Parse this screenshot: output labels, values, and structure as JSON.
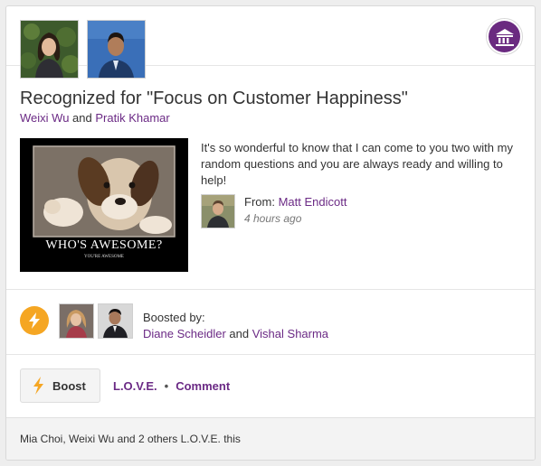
{
  "recognition": {
    "title": "Recognized for \"Focus on Customer Happiness\"",
    "recipients": [
      {
        "name": "Weixi Wu"
      },
      {
        "name": "Pratik Khamar"
      }
    ],
    "connector": "and",
    "badge_icon": "building-icon",
    "badge_color": "#6a2a80",
    "link_color": "#6b2a85"
  },
  "gif": {
    "caption": "WHO'S AWESOME?",
    "subcaption": "YOU'RE AWESOME"
  },
  "message": {
    "text": "It's so wonderful to know that I can come to you two with my random questions and you are always ready and willing to help!",
    "from_label": "From:",
    "sender": "Matt Endicott",
    "timestamp": "4 hours ago"
  },
  "boosts": {
    "icon": "lightning-icon",
    "icon_color": "#f5a623",
    "label": "Boosted by:",
    "boosters": [
      "Diane Scheidler",
      "Vishal Sharma"
    ],
    "connector": "and"
  },
  "actions": {
    "boost_label": "Boost",
    "love_label": "L.O.V.E.",
    "separator": "•",
    "comment_label": "Comment"
  },
  "footer": {
    "text": "Mia Choi, Weixi Wu and 2 others L.O.V.E. this"
  }
}
